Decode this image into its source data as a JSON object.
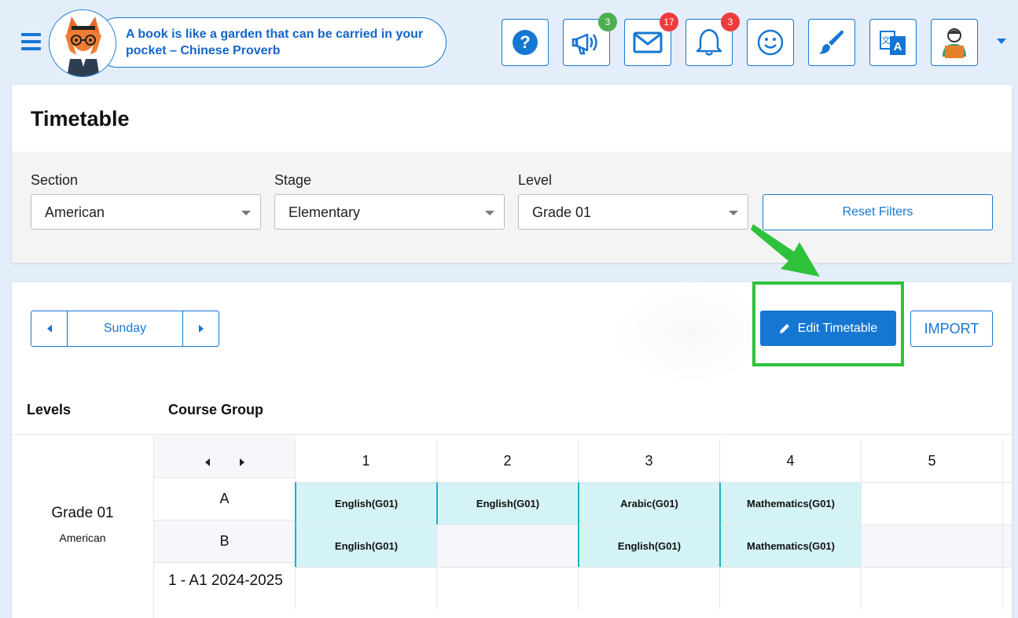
{
  "header": {
    "quote": "A book is like a garden that can be carried in your pocket – Chinese Proverb",
    "buttons": [
      {
        "name": "help-icon"
      },
      {
        "name": "megaphone-icon",
        "badge": "3",
        "badge_color": "#4caf50"
      },
      {
        "name": "mail-icon",
        "badge": "17",
        "badge_color": "#ef3b3b"
      },
      {
        "name": "bell-icon",
        "badge": "3",
        "badge_color": "#ef3b3b"
      },
      {
        "name": "smiley-icon"
      },
      {
        "name": "paintbrush-icon"
      },
      {
        "name": "translate-icon"
      },
      {
        "name": "user-avatar-icon"
      }
    ]
  },
  "page": {
    "title": "Timetable"
  },
  "filters": {
    "section_label": "Section",
    "section_value": "American",
    "stage_label": "Stage",
    "stage_value": "Elementary",
    "level_label": "Level",
    "level_value": "Grade 01",
    "reset_label": "Reset Filters"
  },
  "toolbar": {
    "day": "Sunday",
    "edit_label": "Edit Timetable",
    "import_label": "IMPORT"
  },
  "table": {
    "levels_header": "Levels",
    "course_group_header": "Course Group",
    "level_name": "Grade 01",
    "level_section": "American",
    "slots": [
      "1",
      "2",
      "3",
      "4",
      "5"
    ],
    "groups": [
      "A",
      "B",
      "1 - A1 2024-2025"
    ],
    "rows": [
      [
        "English(G01)",
        "English(G01)",
        "Arabic(G01)",
        "Mathematics(G01)",
        ""
      ],
      [
        "English(G01)",
        "",
        "English(G01)",
        "Mathematics(G01)",
        ""
      ],
      [
        "",
        "",
        "",
        "",
        ""
      ]
    ]
  },
  "colors": {
    "accent": "#1677d2",
    "highlight": "#2ec23a",
    "filled_cell": "#d4f3f6"
  }
}
